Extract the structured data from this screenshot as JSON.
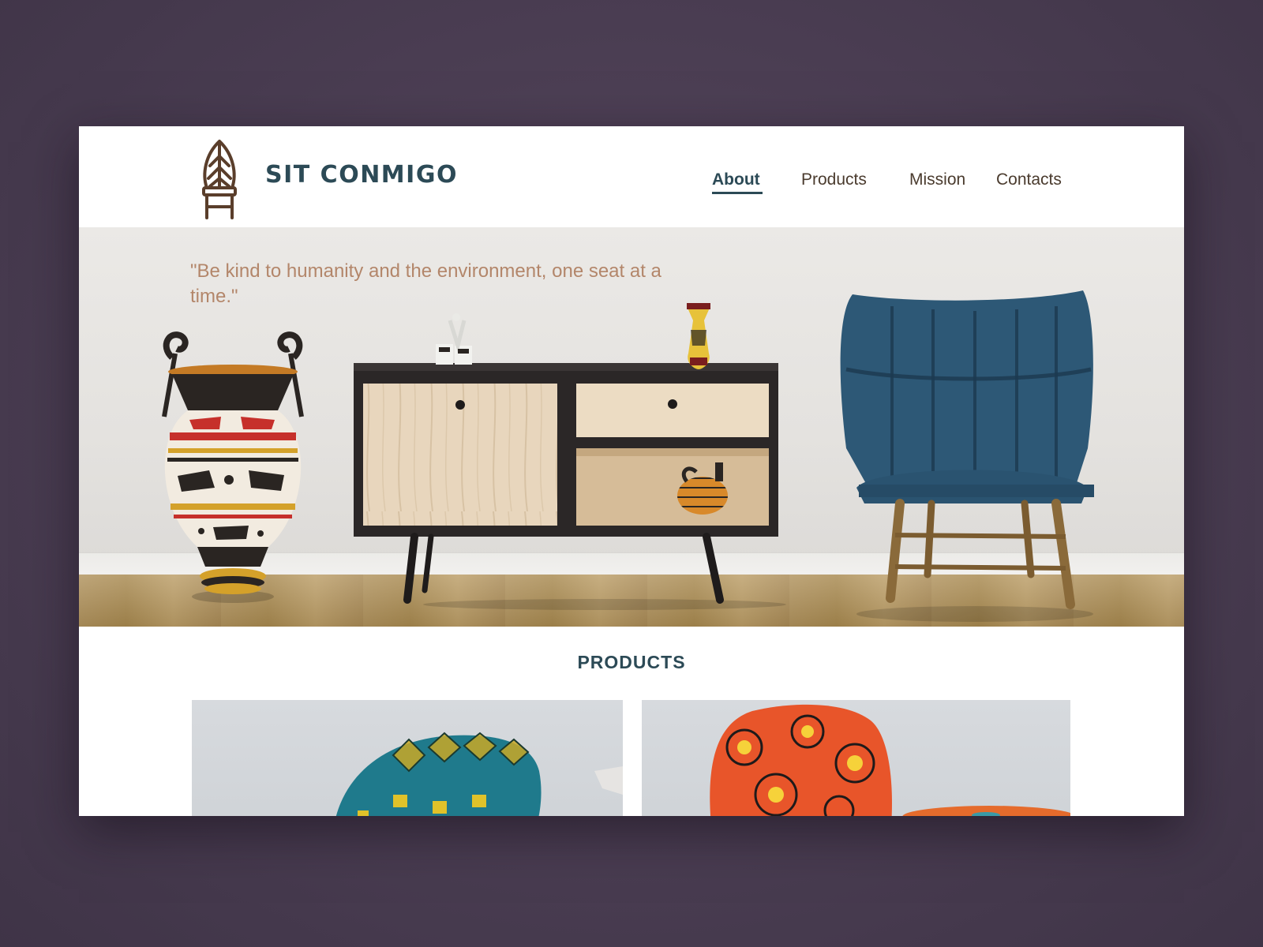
{
  "header": {
    "brand_name": "SIT CONMIGO",
    "logo_icon": "leaf-chair-icon",
    "nav": {
      "about": "About",
      "products": "Products",
      "mission": "Mission",
      "contacts": "Contacts"
    },
    "active_nav": "About"
  },
  "hero": {
    "quote": "\"Be kind to humanity and the environment, one seat at a time.\""
  },
  "products": {
    "heading": "PRODUCTS"
  },
  "colors": {
    "background": "#4a3d52",
    "brand": "#2c4a56",
    "nav_text": "#4a3b2e",
    "quote": "#b3866a",
    "logo": "#5a3e2b"
  }
}
